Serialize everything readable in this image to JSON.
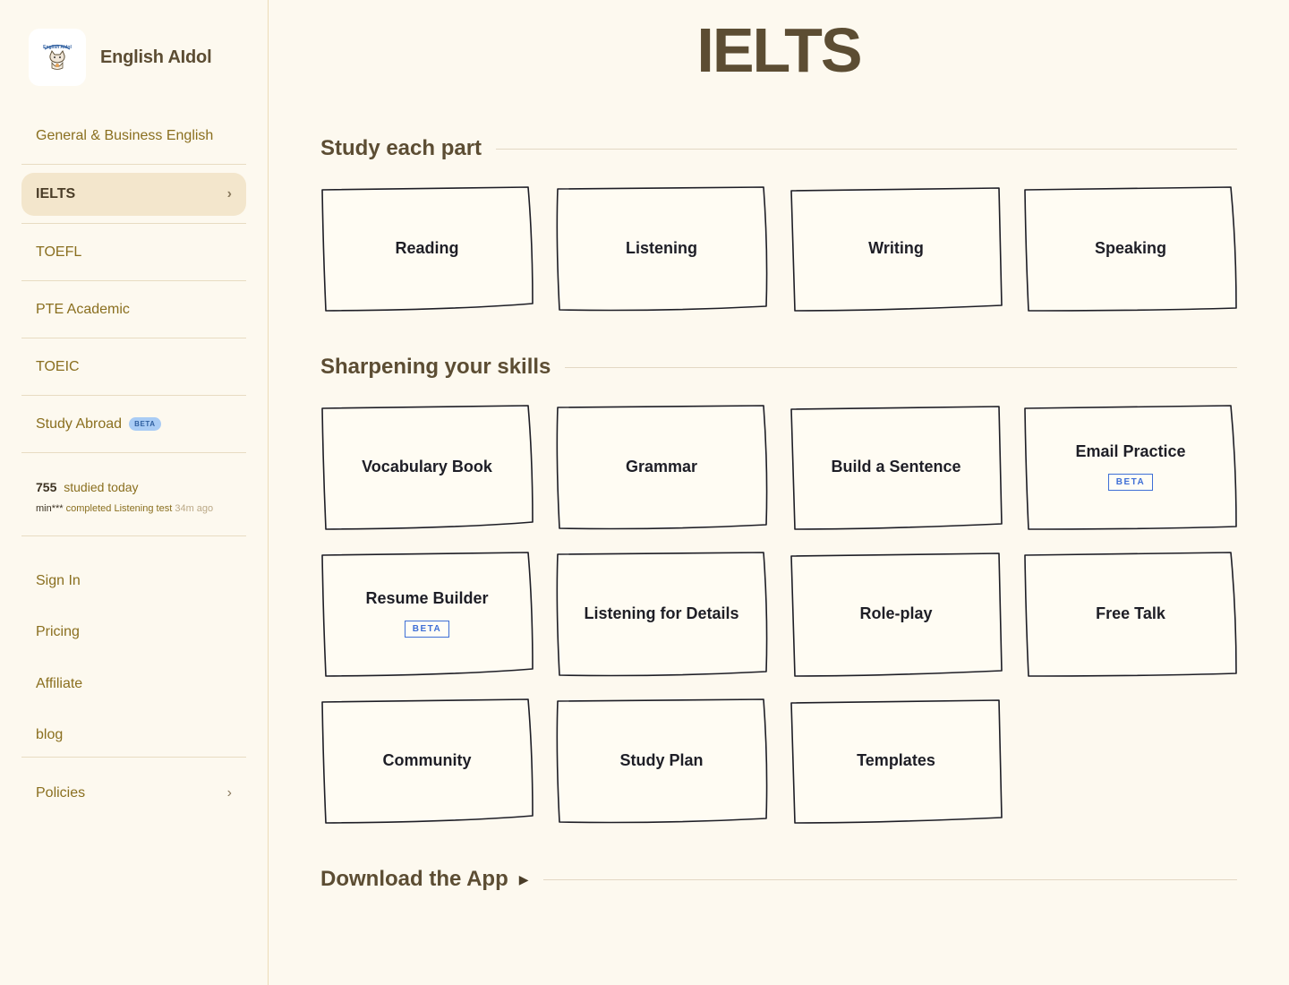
{
  "brand": {
    "name": "English AIdol",
    "logo_icon": "cat-mascot-logo-icon",
    "logo_text": "English AIdol"
  },
  "nav": {
    "items": [
      {
        "label": "General & Business English",
        "active": false
      },
      {
        "label": "IELTS",
        "active": true
      },
      {
        "label": "TOEFL",
        "active": false
      },
      {
        "label": "PTE Academic",
        "active": false
      },
      {
        "label": "TOEIC",
        "active": false
      },
      {
        "label": "Study Abroad",
        "active": false,
        "badge": "BETA"
      }
    ]
  },
  "stats": {
    "count": "755",
    "count_label": "studied today",
    "activity_user": "min***",
    "activity_text": "completed Listening test",
    "activity_ago": "34m ago"
  },
  "links": [
    "Sign In",
    "Pricing",
    "Affiliate",
    "blog"
  ],
  "policies": {
    "label": "Policies"
  },
  "page": {
    "title": "IELTS"
  },
  "sections": {
    "study": {
      "title": "Study each part",
      "cards": [
        {
          "label": "Reading"
        },
        {
          "label": "Listening"
        },
        {
          "label": "Writing"
        },
        {
          "label": "Speaking"
        }
      ]
    },
    "skills": {
      "title": "Sharpening your skills",
      "cards": [
        {
          "label": "Vocabulary Book"
        },
        {
          "label": "Grammar"
        },
        {
          "label": "Build a Sentence"
        },
        {
          "label": "Email Practice",
          "badge": "BETA"
        },
        {
          "label": "Resume Builder",
          "badge": "BETA"
        },
        {
          "label": "Listening for Details"
        },
        {
          "label": "Role-play"
        },
        {
          "label": "Free Talk"
        },
        {
          "label": "Community"
        },
        {
          "label": "Study Plan"
        },
        {
          "label": "Templates"
        }
      ]
    },
    "download": {
      "title": "Download the App",
      "icon": "play-triangle-icon"
    }
  },
  "colors": {
    "background": "#fdf9ef",
    "accent_text": "#8a6f1f",
    "heading": "#5c4d33",
    "active_bg": "#f3e6cc",
    "beta_blue": "#3f6fd6"
  }
}
